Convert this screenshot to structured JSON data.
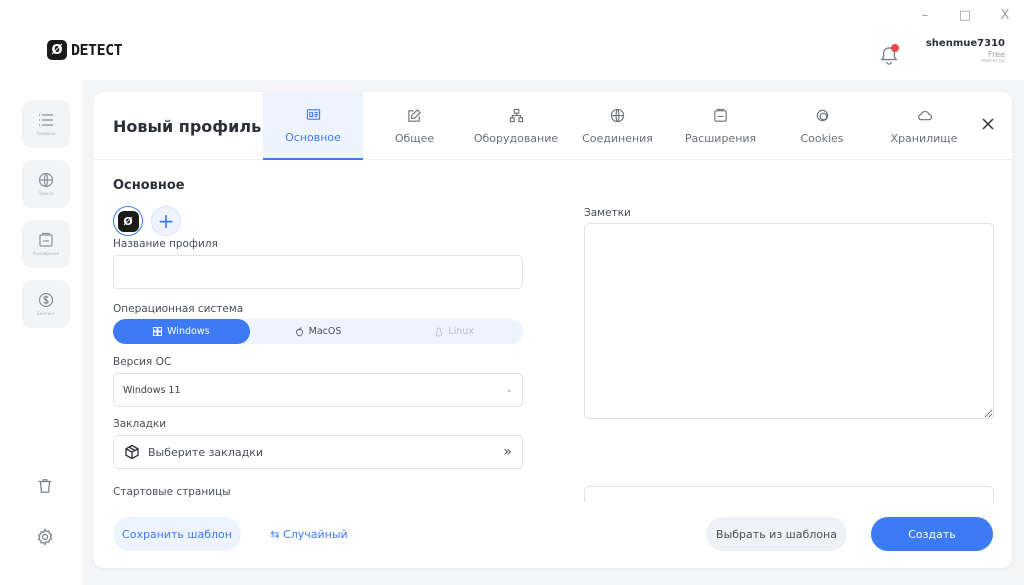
{
  "window": {
    "minimize": "–",
    "maximize": "□",
    "close": "X"
  },
  "brand": {
    "logo_glyph": "Ø",
    "name": "DETECT"
  },
  "user": {
    "name": "shenmue7310",
    "plan": "Free",
    "plan_sub": "навсегда"
  },
  "notification": {
    "has_unread": true,
    "dot_color": "#e5484d"
  },
  "sidebar": {
    "items": [
      {
        "icon": "list-icon",
        "label": "Профили"
      },
      {
        "icon": "globe-icon",
        "label": "Прокси"
      },
      {
        "icon": "extensions-icon",
        "label": "Расширения"
      },
      {
        "icon": "dollar-icon",
        "label": "Биллинг"
      }
    ],
    "bottom": [
      {
        "icon": "trash-icon"
      },
      {
        "icon": "gear-icon"
      }
    ]
  },
  "panel": {
    "title": "Новый профиль",
    "tabs": [
      {
        "label": "Основное",
        "icon": "id-card-icon",
        "active": true
      },
      {
        "label": "Общее",
        "icon": "edit-icon",
        "active": false
      },
      {
        "label": "Оборудование",
        "icon": "hierarchy-icon",
        "active": false
      },
      {
        "label": "Соединения",
        "icon": "globe-icon",
        "active": false
      },
      {
        "label": "Расширения",
        "icon": "extensions-icon",
        "active": false
      },
      {
        "label": "Cookies",
        "icon": "cookie-icon",
        "active": false
      },
      {
        "label": "Хранилище",
        "icon": "cloud-icon",
        "active": false
      }
    ],
    "close": "X"
  },
  "form": {
    "section_title": "Основное",
    "avatar_glyph": "Ø",
    "add_glyph": "+",
    "profile_name": {
      "label": "Название профиля",
      "value": "",
      "placeholder": ""
    },
    "os": {
      "label": "Операционная система",
      "options": [
        {
          "label": "Windows",
          "state": "active"
        },
        {
          "label": "MacOS",
          "state": "normal"
        },
        {
          "label": "Linux",
          "state": "disabled"
        }
      ]
    },
    "os_version": {
      "label": "Версия ОС",
      "value": "Windows 11",
      "chevron": "⌄"
    },
    "bookmarks": {
      "label": "Закладки",
      "value": "Выберите закладки",
      "arrows": "»"
    },
    "start_pages": {
      "label": "Стартовые страницы"
    },
    "notes": {
      "label": "Заметки",
      "value": ""
    }
  },
  "footer": {
    "save_template": "Сохранить шаблон",
    "random": "⇆ Случайный",
    "choose_template": "Выбрать из шаблона",
    "create": "Создать"
  },
  "colors": {
    "accent": "#3d7bf4",
    "accent_light": "#eef4ff",
    "stage_bg": "#f4f5f7"
  }
}
